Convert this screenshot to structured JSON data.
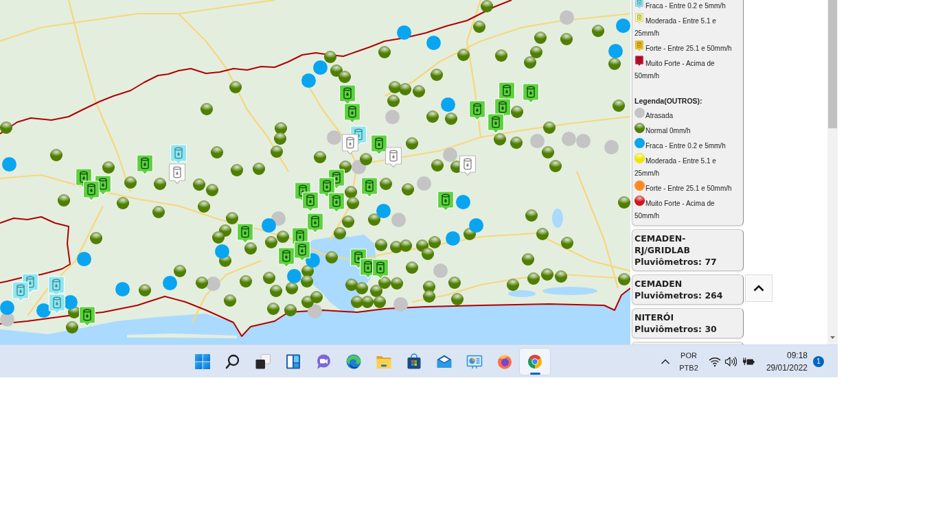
{
  "legend_rain_gauge": {
    "items": [
      {
        "label": "Fraca - Entre 0.2 e 5mm/h",
        "color": "#8ee6f0"
      },
      {
        "label": "Moderada - Entre 5.1 e 25mm/h",
        "color": "#f4f78c"
      },
      {
        "label": "Forte - Entre 25.1 e 50mm/h",
        "color": "#f5c21b"
      },
      {
        "label": "Muito Forte - Acima de 50mm/h",
        "color": "#c8102e"
      }
    ]
  },
  "legend_others": {
    "title": "Legenda(OUTROS):",
    "items": [
      {
        "label": "Atrasada",
        "color": "#c4c4c4",
        "kind": "flat"
      },
      {
        "label": "Normal 0mm/h",
        "color": "#4f7f00",
        "kind": "glossy"
      },
      {
        "label": "Fraca - Entre 0.2 e 5mm/h",
        "color": "#0aa5f0",
        "kind": "flat"
      },
      {
        "label": "Moderada - Entre 5.1 e 25mm/h",
        "color": "#f0e600",
        "kind": "glossy"
      },
      {
        "label": "Forte - Entre 25.1 e 50mm/h",
        "color": "#ff8a24",
        "kind": "flat"
      },
      {
        "label": "Muito Forte - Acima de 50mm/h",
        "color": "#d0141c",
        "kind": "glossy"
      }
    ]
  },
  "sources": [
    {
      "name": "CEMADEN-RJ/GRIDLAB",
      "count": "Pluviômetros: 77"
    },
    {
      "name": "CEMADEN",
      "count": "Pluviômetros: 264"
    },
    {
      "name": "NITERÓI",
      "count": "Pluviômetros: 30"
    }
  ],
  "taskbar": {
    "apps": [
      {
        "selected": false
      },
      {
        "selected": false
      },
      {
        "selected": false
      },
      {
        "selected": false
      },
      {
        "selected": false
      },
      {
        "selected": false
      },
      {
        "selected": false
      },
      {
        "selected": false
      },
      {
        "selected": false
      },
      {
        "selected": false
      },
      {
        "selected": false
      },
      {
        "selected": true
      }
    ],
    "tray": {
      "language": "POR",
      "layout": "PTB2",
      "time": "09:18",
      "date": "29/01/2022",
      "notifications": "1"
    }
  }
}
